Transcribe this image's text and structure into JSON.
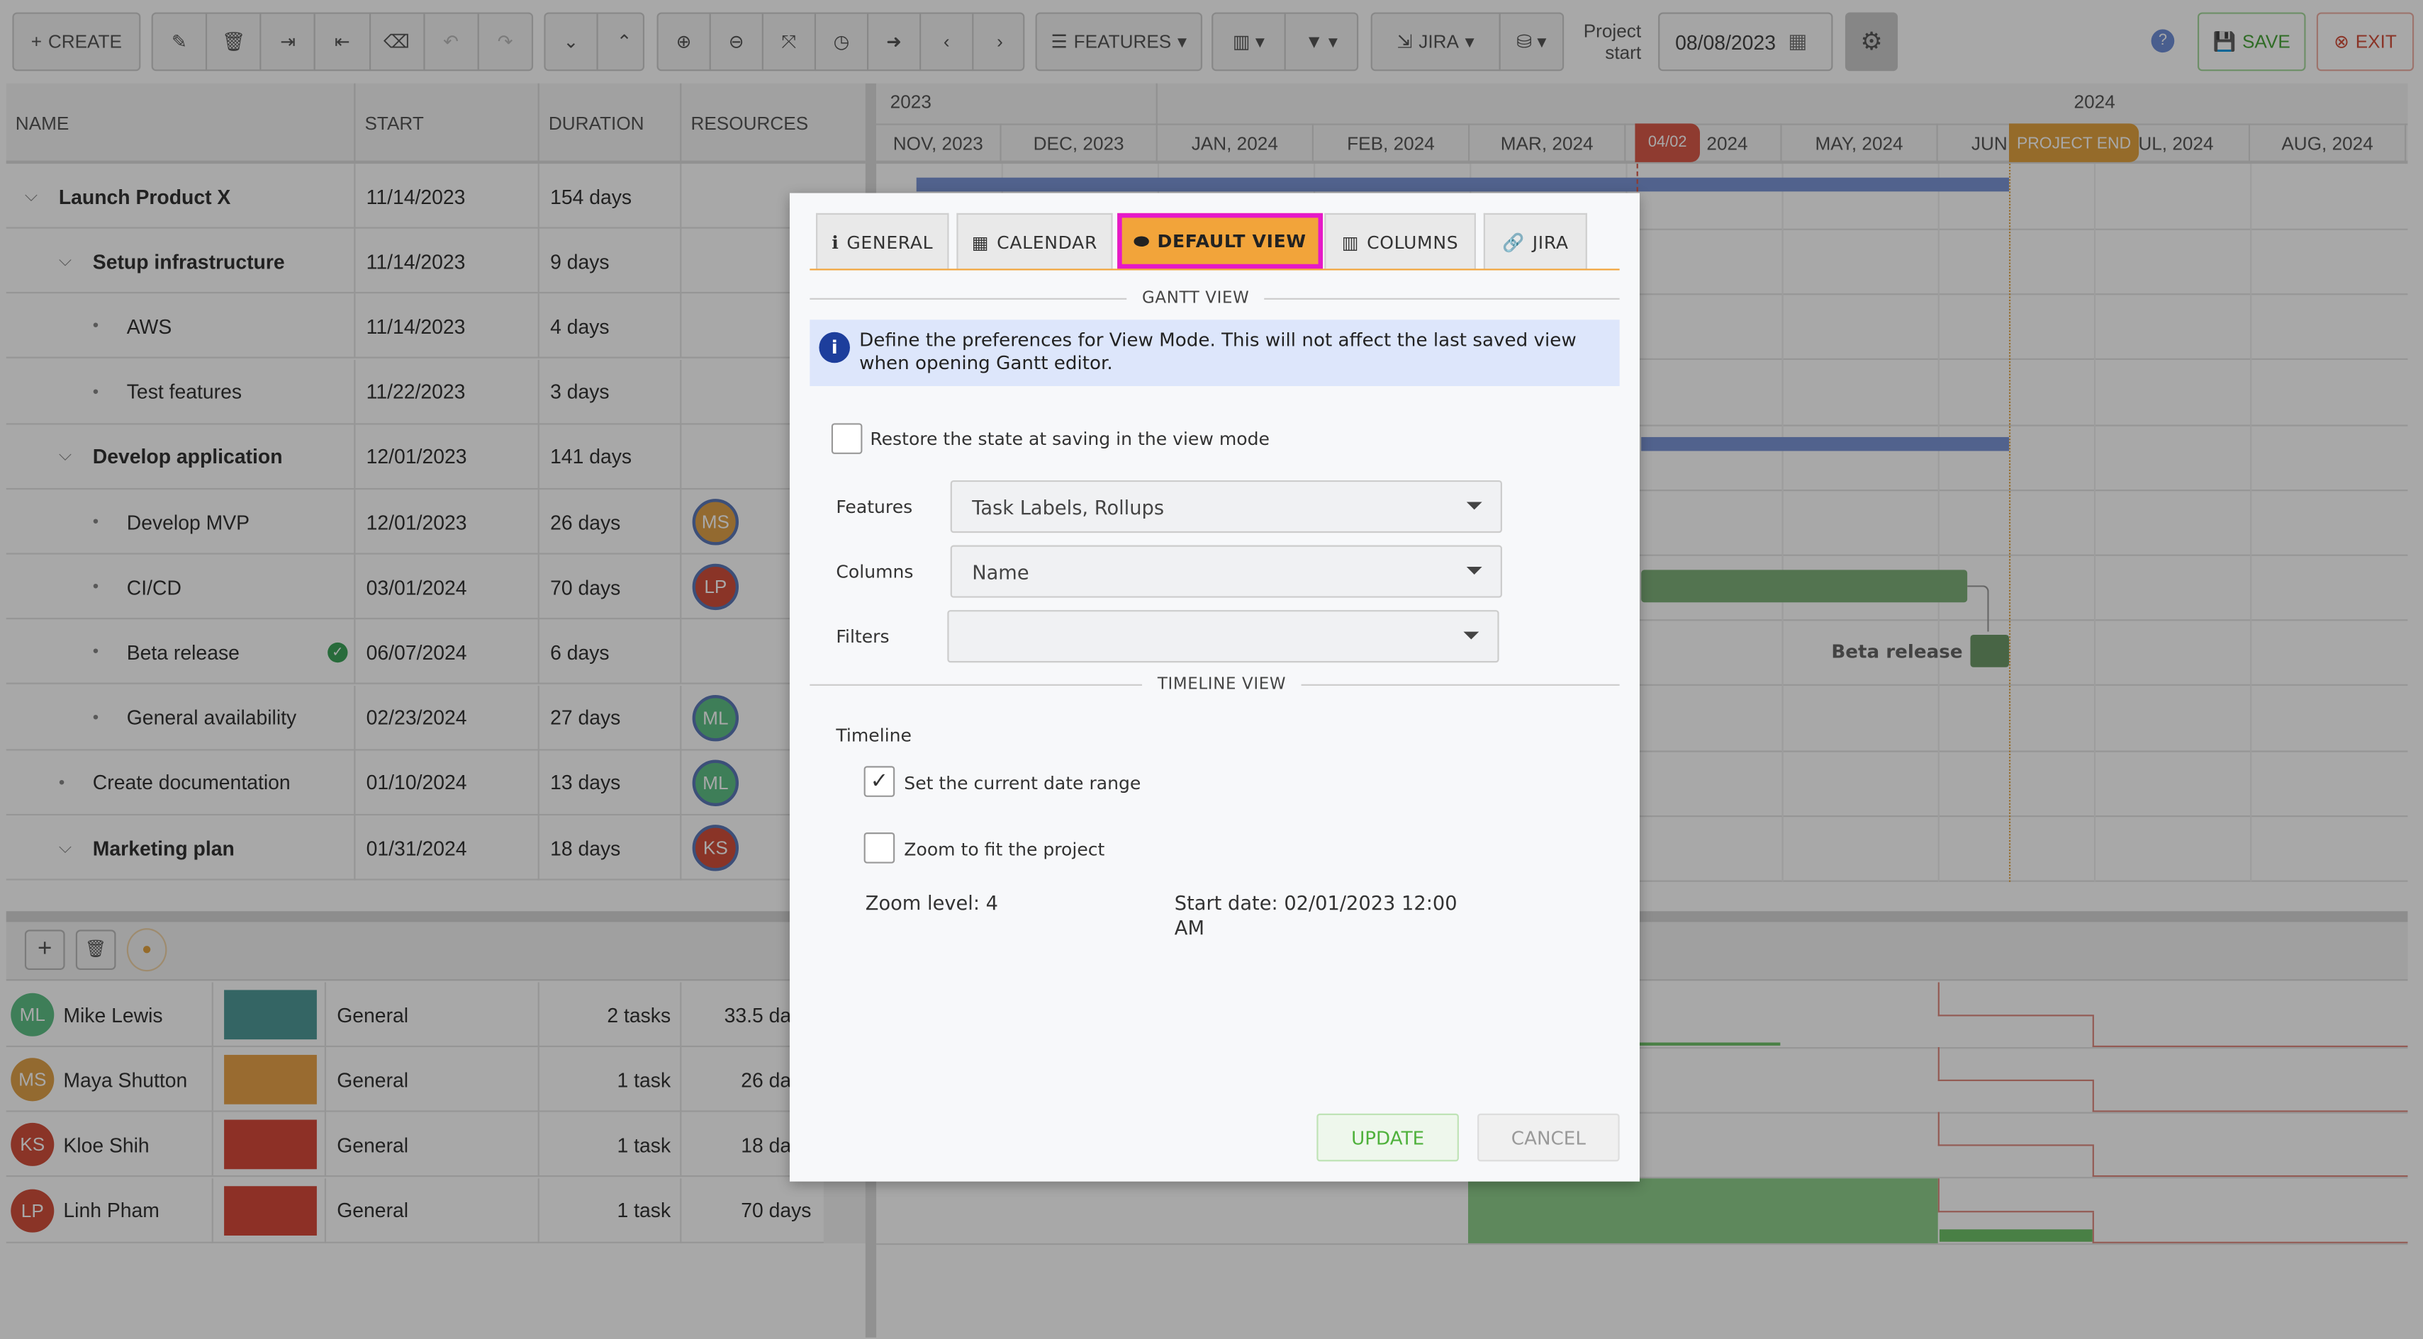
{
  "toolbar": {
    "create": "CREATE",
    "features": "FEATURES",
    "jira": "JIRA",
    "project_start_label": "Project start",
    "project_start_value": "08/08/2023",
    "save": "SAVE",
    "exit": "EXIT"
  },
  "grid": {
    "headers": {
      "name": "NAME",
      "start": "START",
      "duration": "DURATION",
      "resources": "RESOURCES"
    },
    "rows": [
      {
        "name": "Launch Product X",
        "level": 0,
        "type": "group",
        "start": "11/14/2023",
        "duration": "154 days"
      },
      {
        "name": "Setup infrastructure",
        "level": 1,
        "type": "group",
        "start": "11/14/2023",
        "duration": "9 days"
      },
      {
        "name": "AWS",
        "level": 2,
        "type": "task",
        "start": "11/14/2023",
        "duration": "4 days"
      },
      {
        "name": "Test features",
        "level": 2,
        "type": "task",
        "start": "11/22/2023",
        "duration": "3 days"
      },
      {
        "name": "Develop application",
        "level": 1,
        "type": "group",
        "start": "12/01/2023",
        "duration": "141 days"
      },
      {
        "name": "Develop MVP",
        "level": 2,
        "type": "task",
        "start": "12/01/2023",
        "duration": "26 days",
        "resource": "MS",
        "resource_color": "#e0a24a"
      },
      {
        "name": "CI/CD",
        "level": 2,
        "type": "task",
        "start": "03/01/2024",
        "duration": "70 days",
        "resource": "LP",
        "resource_color": "#d2503c"
      },
      {
        "name": "Beta release",
        "level": 2,
        "type": "task",
        "start": "06/07/2024",
        "duration": "6 days",
        "completed": true
      },
      {
        "name": "General availability",
        "level": 2,
        "type": "task",
        "start": "02/23/2024",
        "duration": "27 days",
        "resource": "ML",
        "resource_color": "#5fbf86"
      },
      {
        "name": "Create documentation",
        "level": 1,
        "type": "task",
        "start": "01/10/2024",
        "duration": "13 days",
        "resource": "ML",
        "resource_color": "#5fbf86"
      },
      {
        "name": "Marketing plan",
        "level": 1,
        "type": "group",
        "start": "01/31/2024",
        "duration": "18 days",
        "resource": "KS",
        "resource_color": "#d2503c"
      }
    ]
  },
  "timeline": {
    "years": [
      "2023",
      "2024"
    ],
    "months": [
      "NOV, 2023",
      "DEC, 2023",
      "JAN, 2024",
      "FEB, 2024",
      "MAR, 2024",
      "APR, 2024",
      "MAY, 2024",
      "JUN, 2024",
      "JUL, 2024",
      "AUG, 2024"
    ],
    "today_marker": "04/02",
    "project_end_marker": "PROJECT END",
    "bar_label": "Beta release"
  },
  "resources": {
    "rows": [
      {
        "initials": "ML",
        "name": "Mike Lewis",
        "color": "#4f9998",
        "avatar_color": "#5fbf86",
        "calendar": "General",
        "tasks": "2 tasks",
        "duration": "33.5 days"
      },
      {
        "initials": "MS",
        "name": "Maya Shutton",
        "color": "#e8a34a",
        "avatar_color": "#e0a24a",
        "calendar": "General",
        "tasks": "1 task",
        "duration": "26 days"
      },
      {
        "initials": "KS",
        "name": "Kloe Shih",
        "color": "#d64a3a",
        "avatar_color": "#d2503c",
        "calendar": "General",
        "tasks": "1 task",
        "duration": "18 days"
      },
      {
        "initials": "LP",
        "name": "Linh Pham",
        "color": "#d64a3a",
        "avatar_color": "#d2503c",
        "calendar": "General",
        "tasks": "1 task",
        "duration": "70 days"
      }
    ]
  },
  "dialog": {
    "tabs": [
      {
        "label": "GENERAL",
        "icon": "info-icon"
      },
      {
        "label": "CALENDAR",
        "icon": "calendar-icon"
      },
      {
        "label": "DEFAULT VIEW",
        "icon": "toggle-icon",
        "active": true
      },
      {
        "label": "COLUMNS",
        "icon": "columns-icon"
      },
      {
        "label": "JIRA",
        "icon": "link-icon"
      }
    ],
    "gantt_section": "GANTT VIEW",
    "info": "Define the preferences for View Mode. This will not affect the last saved view when opening Gantt editor.",
    "restore_label": "Restore the state at saving in the view mode",
    "restore_checked": false,
    "features_label": "Features",
    "features_value": "Task Labels, Rollups",
    "columns_label": "Columns",
    "columns_value": "Name",
    "filters_label": "Filters",
    "filters_value": "",
    "timeline_section": "TIMELINE VIEW",
    "timeline_label": "Timeline",
    "date_range_label": "Set the current date range",
    "date_range_checked": true,
    "zoom_fit_label": "Zoom to fit the project",
    "zoom_fit_checked": false,
    "zoom_level": "Zoom level: 4",
    "start_date": "Start date: 02/01/2023 12:00 AM",
    "update": "UPDATE",
    "cancel": "CANCEL",
    "accent": "#f2a43a",
    "highlight": "#e619c8"
  }
}
